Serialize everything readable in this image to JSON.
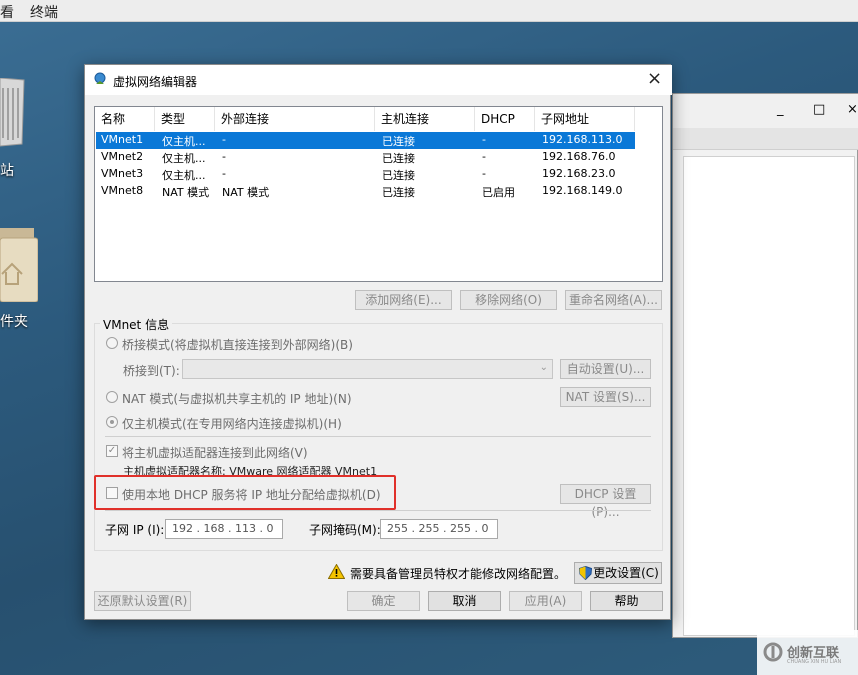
{
  "menubar": {
    "item_left": "看",
    "item_terminal": "终端"
  },
  "desktop": {
    "trash_label": "站",
    "folder_label": "件夹"
  },
  "bg_window": {
    "minimize": "_",
    "maximize": "□",
    "close": "×"
  },
  "dialog": {
    "title": "虚拟网络编辑器",
    "close": "×",
    "table": {
      "headers": [
        "名称",
        "类型",
        "外部连接",
        "主机连接",
        "DHCP",
        "子网地址"
      ],
      "rows": [
        [
          "VMnet1",
          "仅主机...",
          "-",
          "已连接",
          "-",
          "192.168.113.0"
        ],
        [
          "VMnet2",
          "仅主机...",
          "-",
          "已连接",
          "-",
          "192.168.76.0"
        ],
        [
          "VMnet3",
          "仅主机...",
          "-",
          "已连接",
          "-",
          "192.168.23.0"
        ],
        [
          "VMnet8",
          "NAT 模式",
          "NAT 模式",
          "已连接",
          "已启用",
          "192.168.149.0"
        ]
      ]
    },
    "buttons": {
      "add_network": "添加网络(E)...",
      "remove_network": "移除网络(O)",
      "rename_network": "重命名网络(A)...",
      "auto_settings": "自动设置(U)...",
      "nat_settings": "NAT 设置(S)...",
      "dhcp_settings": "DHCP 设置(P)...",
      "change_settings": "更改设置(C)",
      "restore_defaults": "还原默认设置(R)",
      "ok": "确定",
      "cancel": "取消",
      "apply": "应用(A)",
      "help": "帮助"
    },
    "vmnet_info": {
      "group_label": "VMnet 信息",
      "bridge_mode": "桥接模式(将虚拟机直接连接到外部网络)(B)",
      "bridge_to_label": "桥接到(T):",
      "nat_mode": "NAT 模式(与虚拟机共享主机的 IP 地址)(N)",
      "host_only_mode": "仅主机模式(在专用网络内连接虚拟机)(H)",
      "connect_adapter": "将主机虚拟适配器连接到此网络(V)",
      "adapter_name": "主机虚拟适配器名称: VMware 网络适配器 VMnet1",
      "use_dhcp": "使用本地 DHCP 服务将 IP 地址分配给虚拟机(D)",
      "subnet_ip_label": "子网 IP (I):",
      "subnet_ip_value": "192 . 168 . 113 . 0",
      "subnet_mask_label": "子网掩码(M):",
      "subnet_mask_value": "255 . 255 . 255 . 0",
      "selected_mode": "host-only",
      "connect_adapter_checked": true,
      "use_dhcp_checked": false
    },
    "admin_notice": "需要具备管理员特权才能修改网络配置。"
  },
  "watermark": {
    "text": "创新互联",
    "sub": "CHUANG XIN HU LIAN"
  },
  "colors": {
    "selection": "#0a78d7",
    "highlight_border": "#e0302a",
    "warning": "#f5c400"
  }
}
